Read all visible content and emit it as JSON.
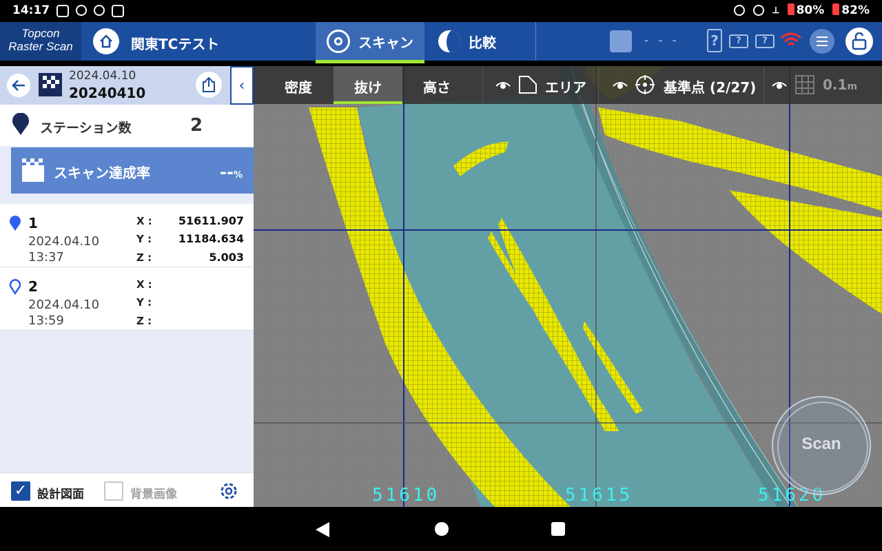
{
  "status_bar": {
    "time": "14:17",
    "battery1": "80%",
    "battery2": "82%"
  },
  "app": {
    "logo_line1": "Topcon",
    "logo_line2": "Raster Scan",
    "project_name": "関東TCテスト",
    "tab_scan": "スキャン",
    "tab_compare": "比較",
    "instrument_status": "- - -"
  },
  "panel": {
    "date": "2024.04.10",
    "name": "20240410",
    "station_count_label": "ステーション数",
    "station_count": "2",
    "scan_rate_label": "スキャン達成率",
    "scan_rate_value": "--",
    "scan_rate_unit": "%",
    "stations": [
      {
        "num": "1",
        "date": "2024.04.10",
        "time": "13:37",
        "x": "51611.907",
        "y": "11184.634",
        "z": "5.003",
        "filled": true
      },
      {
        "num": "2",
        "date": "2024.04.10",
        "time": "13:59",
        "x": "",
        "y": "",
        "z": "",
        "filled": false
      }
    ],
    "axis_x": "X :",
    "axis_y": "Y :",
    "axis_z": "Z :",
    "design_drawing": "設計図面",
    "background_image": "背景画像",
    "design_drawing_checked": true,
    "background_image_checked": false
  },
  "toolbar": {
    "density": "密度",
    "missing": "抜け",
    "height": "高さ",
    "area": "エリア",
    "benchmark": "基準点 (2/27)",
    "grid_size": "0.1",
    "grid_unit": "m"
  },
  "map": {
    "coord_labels": [
      "51610",
      "51615",
      "51620"
    ],
    "scan_button": "Scan"
  },
  "colors": {
    "accent": "#1c4ea0",
    "tab_underline": "#a3e635",
    "scan_point": "#e8e800",
    "area_fill": "#5fa3a8",
    "coord_text": "#3ef0f0"
  }
}
